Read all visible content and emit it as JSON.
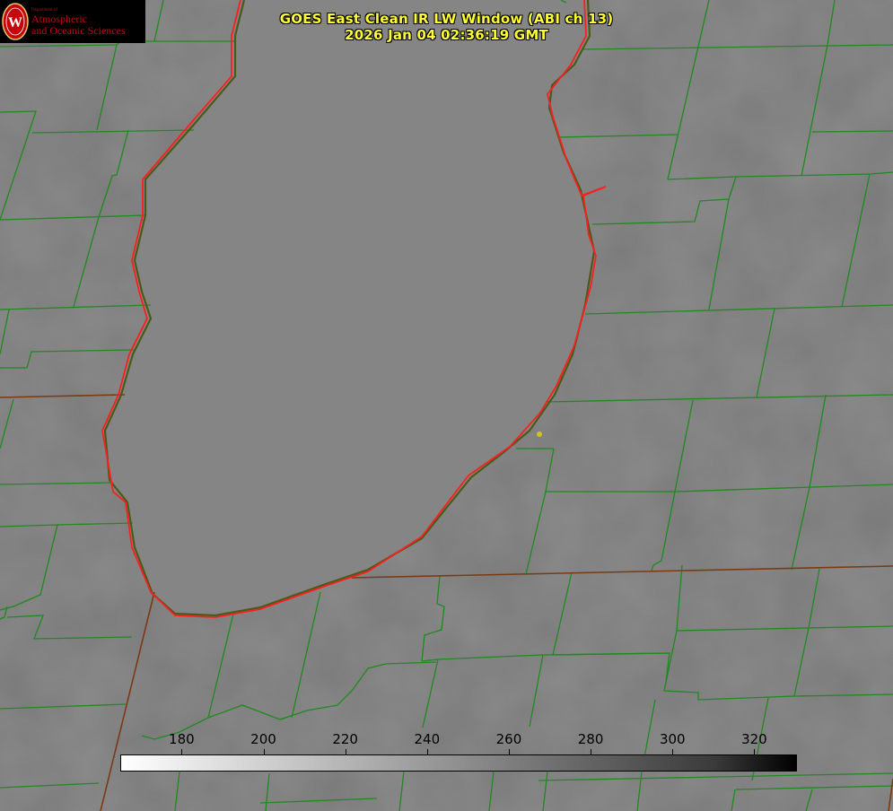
{
  "logo": {
    "department": "Department of",
    "line1": "Atmospheric",
    "line2": "and Oceanic Sciences",
    "seal_letter": "W"
  },
  "title": {
    "line1": "GOES East Clean IR LW Window (ABI ch 13)",
    "line2": "2026 Jan 04 02:36:19 GMT"
  },
  "colorbar": {
    "ticks": [
      "180",
      "200",
      "220",
      "240",
      "260",
      "280",
      "300",
      "320"
    ],
    "scale_min": 165,
    "scale_max": 330,
    "gradient": "white-to-black"
  },
  "colors": {
    "background": "#7d7d7d",
    "lake": "#858585",
    "county_lines": "#1f8a1f",
    "state_lines": "#7a3a14",
    "shoreline": "#ff1e1e",
    "title": "#ffff33",
    "marker": "#d4c21a"
  }
}
